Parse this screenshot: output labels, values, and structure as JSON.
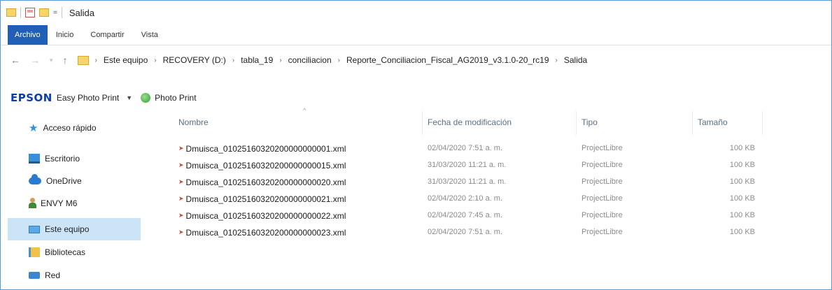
{
  "window": {
    "title": "Salida",
    "qa_dropdown": "="
  },
  "ribbon": {
    "tabs": [
      {
        "label": "Archivo",
        "active": true
      },
      {
        "label": "Inicio",
        "active": false
      },
      {
        "label": "Compartir",
        "active": false
      },
      {
        "label": "Vista",
        "active": false
      }
    ]
  },
  "address": {
    "back": "←",
    "forward": "→",
    "recent": "▾",
    "up": "↑",
    "breadcrumbs": [
      "Este equipo",
      "RECOVERY (D:)",
      "tabla_19",
      "conciliacion",
      "Reporte_Conciliacion_Fiscal_AG2019_v3.1.0-20_rc19",
      "Salida"
    ]
  },
  "epson_toolbar": {
    "logo": "EPSON",
    "easy_photo_print": "Easy Photo Print",
    "caret": "▼",
    "photo_print": "Photo Print"
  },
  "nav_pane": {
    "items": [
      {
        "label": "Acceso rápido",
        "icon": "star-icon"
      },
      {
        "label": "Escritorio",
        "icon": "desktop-icon"
      },
      {
        "label": "OneDrive",
        "icon": "cloud-icon"
      },
      {
        "label": "ENVY M6",
        "icon": "user-icon"
      },
      {
        "label": "Este equipo",
        "icon": "computer-icon",
        "selected": true
      },
      {
        "label": "Bibliotecas",
        "icon": "library-icon"
      },
      {
        "label": "Red",
        "icon": "network-icon"
      }
    ]
  },
  "file_list": {
    "columns": {
      "name": "Nombre",
      "date": "Fecha de modificación",
      "type": "Tipo",
      "size": "Tamaño"
    },
    "sort_indicator": "^",
    "file_icon": "ms-project-file-icon",
    "files": [
      {
        "name": "Dmuisca_01025160320200000000001.xml",
        "date": "02/04/2020 7:51 a. m.",
        "type": "ProjectLibre",
        "size": "100 KB"
      },
      {
        "name": "Dmuisca_01025160320200000000015.xml",
        "date": "31/03/2020 11:21 a. m.",
        "type": "ProjectLibre",
        "size": "100 KB"
      },
      {
        "name": "Dmuisca_01025160320200000000020.xml",
        "date": "31/03/2020 11:21 a. m.",
        "type": "ProjectLibre",
        "size": "100 KB"
      },
      {
        "name": "Dmuisca_01025160320200000000021.xml",
        "date": "02/04/2020 2:10 a. m.",
        "type": "ProjectLibre",
        "size": "100 KB"
      },
      {
        "name": "Dmuisca_01025160320200000000022.xml",
        "date": "02/04/2020 7:45 a. m.",
        "type": "ProjectLibre",
        "size": "100 KB"
      },
      {
        "name": "Dmuisca_01025160320200000000023.xml",
        "date": "02/04/2020 7:51 a. m.",
        "type": "ProjectLibre",
        "size": "100 KB"
      }
    ]
  },
  "colors": {
    "accent": "#1f5fb8",
    "selection": "#cce4f7",
    "epson_blue": "#0b3ea8",
    "window_border": "#5b9bd5"
  }
}
